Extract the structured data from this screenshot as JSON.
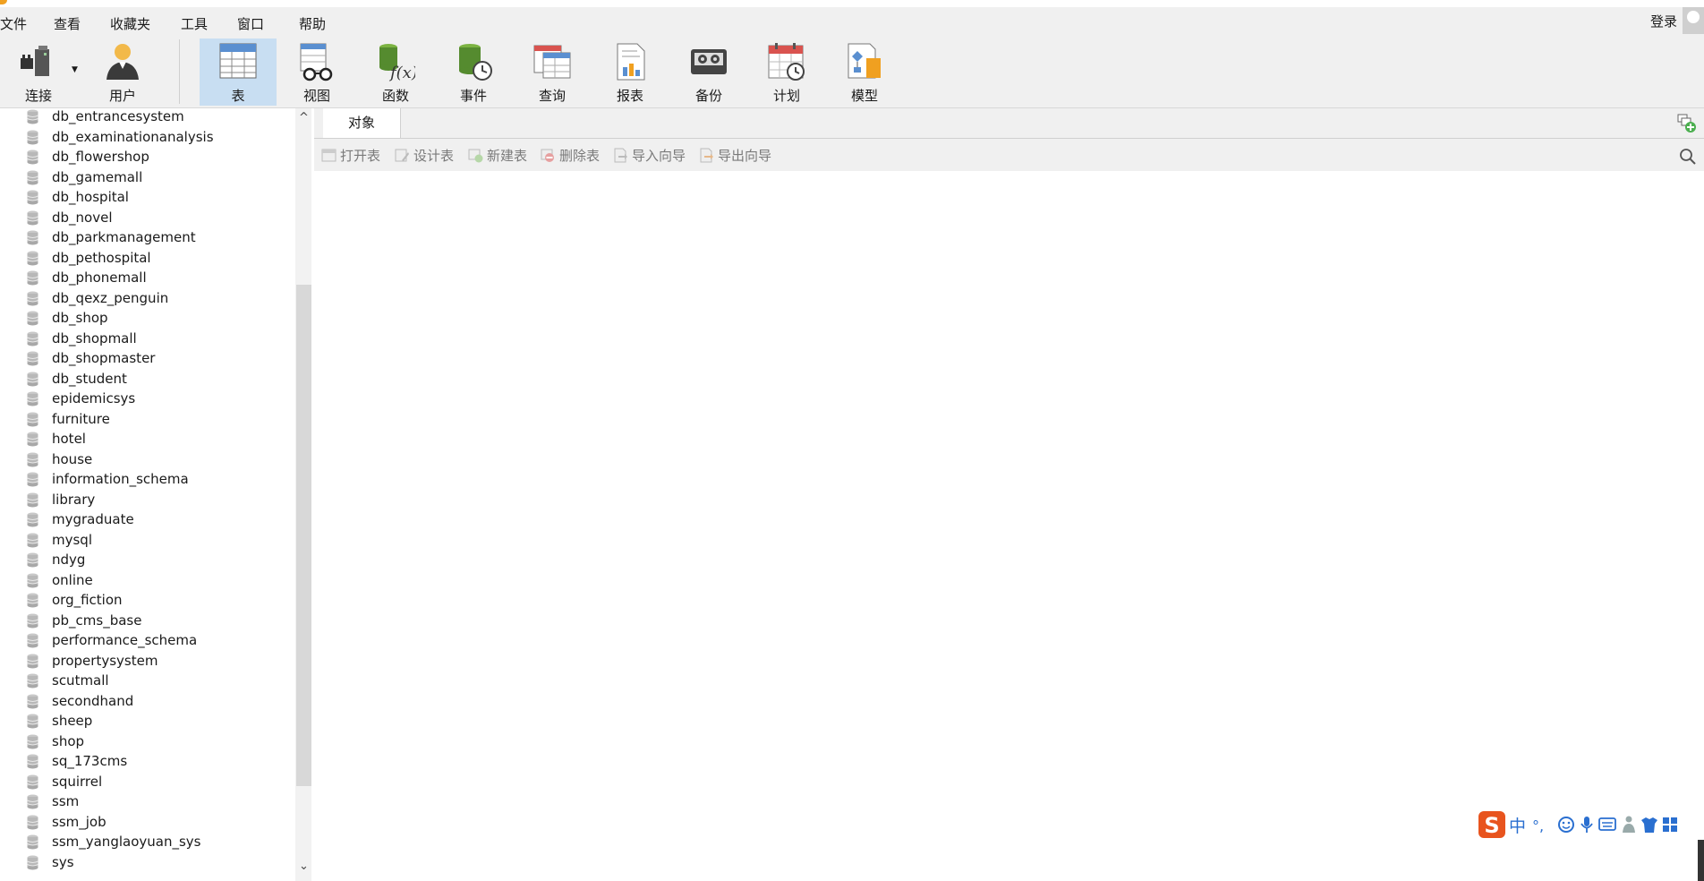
{
  "menubar": {
    "items": [
      "文件",
      "查看",
      "收藏夹",
      "工具",
      "窗口",
      "帮助"
    ],
    "login_label": "登录"
  },
  "toolbar": {
    "connect_label": "连接",
    "user_label": "用户",
    "table_label": "表",
    "view_label": "视图",
    "function_label": "函数",
    "event_label": "事件",
    "query_label": "查询",
    "report_label": "报表",
    "backup_label": "备份",
    "schedule_label": "计划",
    "model_label": "模型",
    "active": "表"
  },
  "objects_panel": {
    "tab_label": "对象",
    "actions": [
      "打开表",
      "设计表",
      "新建表",
      "删除表",
      "导入向导",
      "导出向导"
    ]
  },
  "sidebar": {
    "databases": [
      "db_entrancesystem",
      "db_examinationanalysis",
      "db_flowershop",
      "db_gamemall",
      "db_hospital",
      "db_novel",
      "db_parkmanagement",
      "db_pethospital",
      "db_phonemall",
      "db_qexz_penguin",
      "db_shop",
      "db_shopmall",
      "db_shopmaster",
      "db_student",
      "epidemicsys",
      "furniture",
      "hotel",
      "house",
      "information_schema",
      "library",
      "mygraduate",
      "mysql",
      "ndyg",
      "online",
      "org_fiction",
      "pb_cms_base",
      "performance_schema",
      "propertysystem",
      "scutmall",
      "secondhand",
      "sheep",
      "shop",
      "sq_173cms",
      "squirrel",
      "ssm",
      "ssm_job",
      "ssm_yanglaoyuan_sys",
      "sys"
    ]
  },
  "ime": {
    "mode_label": "中"
  },
  "colors": {
    "toolbar_bg": "#f0f0f0",
    "active_tab_bg": "#c8def2",
    "db_icon": "#b8b8b8",
    "ime_brand": "#e8541e"
  }
}
